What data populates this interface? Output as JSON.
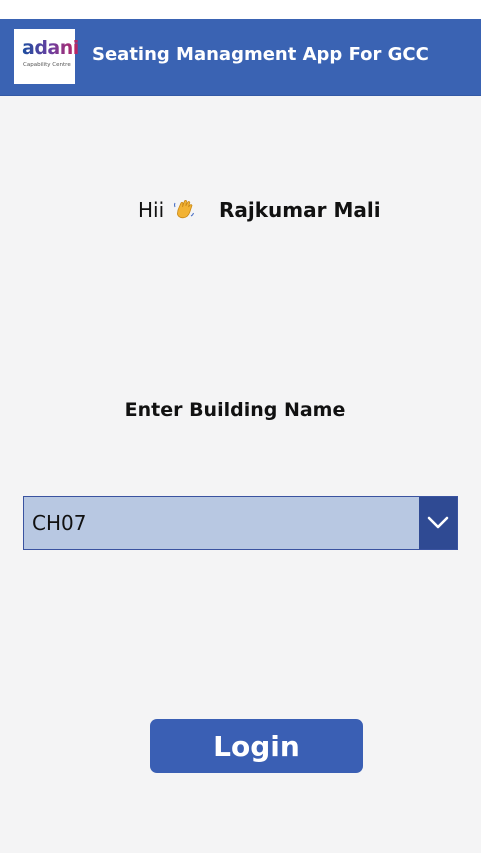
{
  "header": {
    "logo_text": "adani",
    "logo_subtext": "Capability Centre",
    "title": "Seating Managment App For GCC"
  },
  "greeting": {
    "prefix": "Hii",
    "wave_icon": "waving-hand-emoji",
    "user_name": "Rajkumar Mali"
  },
  "building": {
    "prompt": "Enter Building Name",
    "selected": "CH07",
    "chevron_icon": "chevron-down-icon"
  },
  "actions": {
    "login_label": "Login"
  },
  "colors": {
    "header_bg": "#3a63b3",
    "dropdown_bg": "#b8c8e2",
    "dropdown_button": "#2f4a93",
    "login_bg": "#3a5fb4",
    "page_bg": "#f4f4f5"
  }
}
